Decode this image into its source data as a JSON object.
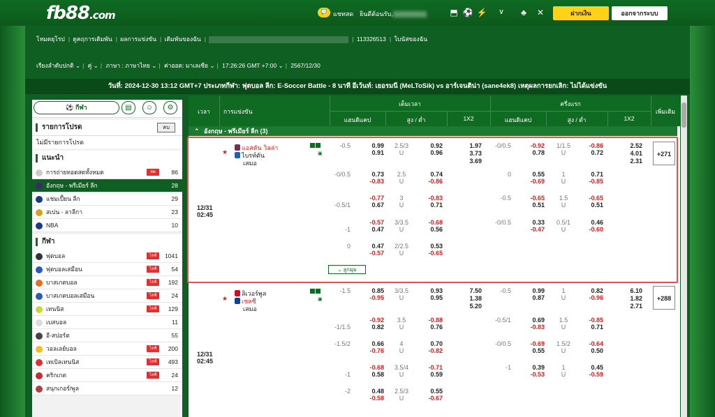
{
  "header": {
    "logo_main": "fb88",
    "logo_suffix": ".com",
    "chat": "แชทสด",
    "welcome": "ยินดีต้อนรับ,",
    "deposit": "ฝากเงิน",
    "logout": "ออกจากระบบ"
  },
  "nav1": {
    "home": "โหมดยุโรป",
    "history": "ดูคฤการเดิมพัน",
    "results": "ผลการแข่งขัน",
    "statement": "เดิมพันของฉัน",
    "account_id": "113326513",
    "bonus": "โบนัสของฉัน"
  },
  "nav2": {
    "sort": "เรียงลำดับปกติ",
    "odds": "คู่",
    "language": "ภาษา : ภาษาไทย",
    "odds_type": "ค่าออด: มาเลเซีย",
    "time": "17:26:26 GMT +7:00",
    "date": "2567/12/30"
  },
  "match_bar": "วันที่: 2024-12-30 13:12 GMT+7 ประเภทกีฬา: ฟุตบอล ลีก: E-Soccer Battle - 8 นาที อีเว้นท์: เยอรมนี (MeLToSik) vs อาร์เจนติน่า (sane4ek8) เหตุผลการยกเลิก: ไม่ได้แข่งขัน",
  "sidebar": {
    "sport_btn": "กีฬา",
    "promo_title": "รายการโปรด",
    "promo_btn": "ลบ",
    "no_promo": "ไม่มีรายการโปรด",
    "rec_title": "แนะนำ",
    "rec": [
      {
        "label": "การถ่ายทอดสดทั้งหมด",
        "count": "86",
        "live": "สด"
      },
      {
        "label": "อังกฤษ - พรีเมียร์ ลีก",
        "count": "28"
      },
      {
        "label": "แชมเปี้ยน ลีก",
        "count": "29"
      },
      {
        "label": "สเปน - ลาลีกา",
        "count": "23"
      },
      {
        "label": "NBA",
        "count": "10"
      }
    ],
    "sport_title": "กีฬา",
    "sports": [
      {
        "label": "ฟุตบอล",
        "count": "1041",
        "live": "ไลฟ์",
        "color": "#333"
      },
      {
        "label": "ฟุตบอลเสมือน",
        "count": "54",
        "live": "ไลฟ์",
        "color": "#2a5ab8"
      },
      {
        "label": "บาสเกตบอล",
        "count": "192",
        "live": "ไลฟ์",
        "color": "#e07020"
      },
      {
        "label": "บาสเกตบอลเสมือน",
        "count": "24",
        "live": "ไลฟ์",
        "color": "#2a5ab8"
      },
      {
        "label": "เทนนิส",
        "count": "129",
        "live": "ไลฟ์",
        "color": "#c8d830"
      },
      {
        "label": "เบสบอล",
        "count": "11",
        "color": "#ddd"
      },
      {
        "label": "อี-สปอร์ต",
        "count": "55",
        "color": "#444"
      },
      {
        "label": "วอลเลย์บอล",
        "count": "200",
        "live": "ไลฟ์",
        "color": "#f0c020"
      },
      {
        "label": "เทเบิลเทนนิส",
        "count": "493",
        "live": "ไลฟ์",
        "color": "#e03030"
      },
      {
        "label": "คริกเกต",
        "count": "24",
        "live": "ไลฟ์",
        "color": "#c03030"
      },
      {
        "label": "สนุกเกอร์/พูล",
        "count": "12",
        "color": "#b04040"
      }
    ]
  },
  "table": {
    "time": "เวลา",
    "match": "การแข่งขัน",
    "full": "เต็มเวลา",
    "half": "ครึ่งแรก",
    "more": "เพิ่มเติม",
    "hdp": "แฮนดิแคป",
    "ou": "สูง / ต่ำ",
    "x12": "1X2",
    "league": "อังกฤษ - พรีเมียร์ ลีก (3)"
  },
  "match1": {
    "date": "12/31",
    "time": "02:45",
    "home": "แอสตัน วิลล่า",
    "away": "ไบรท์ตัน",
    "draw": "เสมอ",
    "more": "+271",
    "expand": "ลูกมุม"
  },
  "match2": {
    "date": "12/31",
    "time": "02:45",
    "home": "ลิเวอร์พูล",
    "away": "เชลซี",
    "draw": "เสมอ",
    "more": "+288"
  },
  "colors": {
    "brand_green": "#0f6a22",
    "accent_yellow": "#ffd21a",
    "negative": "#e21b1b"
  }
}
